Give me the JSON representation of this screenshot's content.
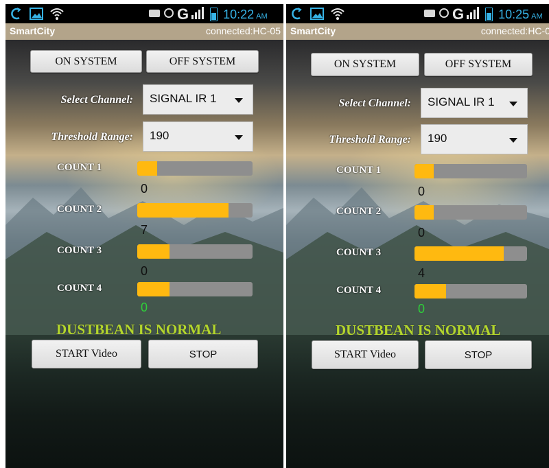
{
  "screens": [
    {
      "status_bar": {
        "time": "10:22",
        "ampm": "AM",
        "network": "G"
      },
      "app_title": "SmartCity",
      "connection": "connected:HC-05",
      "on_button": "ON SYSTEM",
      "off_button": "OFF SYSTEM",
      "channel_label": "Select Channel:",
      "channel_value": "SIGNAL IR 1",
      "threshold_label": "Threshold Range:",
      "threshold_value": "190",
      "counts": [
        {
          "label": "COUNT 1",
          "value": "0",
          "level": 0.17
        },
        {
          "label": "COUNT 2",
          "value": "7",
          "level": 0.79
        },
        {
          "label": "COUNT 3",
          "value": "0",
          "level": 0.28
        },
        {
          "label": "COUNT 4",
          "value": "0",
          "level": 0.28
        }
      ],
      "status_message": "DUSTBEAN IS NORMAL",
      "start_button": "START Video",
      "stop_button": "STOP"
    },
    {
      "status_bar": {
        "time": "10:25",
        "ampm": "AM",
        "network": "G"
      },
      "app_title": "SmartCity",
      "connection": "connected:HC-0",
      "on_button": "ON SYSTEM",
      "off_button": "OFF SYSTEM",
      "channel_label": "Select Channel:",
      "channel_value": "SIGNAL IR 1",
      "threshold_label": "Threshold Range:",
      "threshold_value": "190",
      "counts": [
        {
          "label": "COUNT 1",
          "value": "0",
          "level": 0.17
        },
        {
          "label": "COUNT 2",
          "value": "0",
          "level": 0.17
        },
        {
          "label": "COUNT 3",
          "value": "4",
          "level": 0.79
        },
        {
          "label": "COUNT 4",
          "value": "0",
          "level": 0.28
        }
      ],
      "status_message": "DUSTBEAN IS NORMAL",
      "start_button": "START Video",
      "stop_button": "STOP"
    }
  ],
  "colors": {
    "accent": "#36b3e6",
    "appbar": "#b3a48a",
    "progress_fill": "#ffb910",
    "progress_track": "#8e8e8e",
    "status_text": "#b3d62c",
    "zero_count_text": "#2ecf3a"
  },
  "icons": [
    "sync-icon",
    "image-icon",
    "wifi-icon",
    "bluetooth-icon",
    "data-icon",
    "signal-icon",
    "battery-icon",
    "dropdown-caret-icon"
  ]
}
